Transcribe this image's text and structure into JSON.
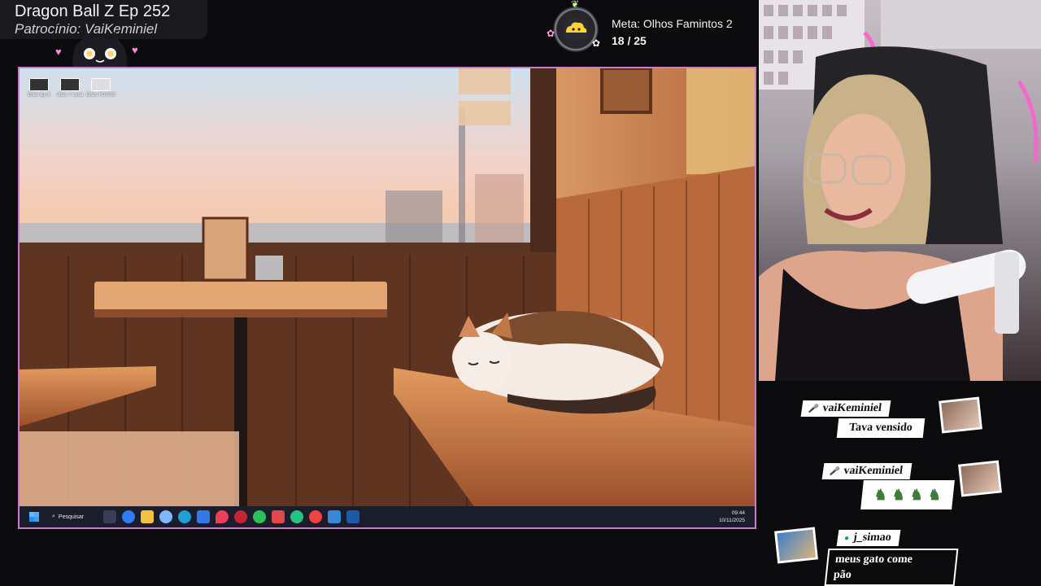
{
  "stream": {
    "title": "Dragon Ball Z Ep 252",
    "sponsor": "Patrocínio: VaiKeminiel"
  },
  "goal": {
    "title": "Meta: Olhos Famintos 2",
    "progress_text": "18 / 25",
    "current": 18,
    "total": 25
  },
  "desktop": {
    "icons": [
      {
        "label": "Elfen Ep 6",
        "icon": "video-file-icon"
      },
      {
        "label": "elfen 7 cena",
        "icon": "video-file-icon"
      },
      {
        "label": "Elfen FOTOS",
        "icon": "image-folder-icon"
      }
    ],
    "taskbar": {
      "search_label": "Pesquisar",
      "time": "09:44",
      "date": "10/11/2025"
    }
  },
  "chat": [
    {
      "user": "vaiKeminiel",
      "text": "Tava vensido"
    },
    {
      "user": "vaiKeminiel",
      "text": "",
      "emotes": "robot-emotes"
    },
    {
      "user": "j_simao",
      "text": "meus gato come\npão"
    }
  ],
  "colors": {
    "accent_border": "#c77dcc",
    "heart_pink": "#ff86d8",
    "taskbar": "#1a1d2a"
  }
}
